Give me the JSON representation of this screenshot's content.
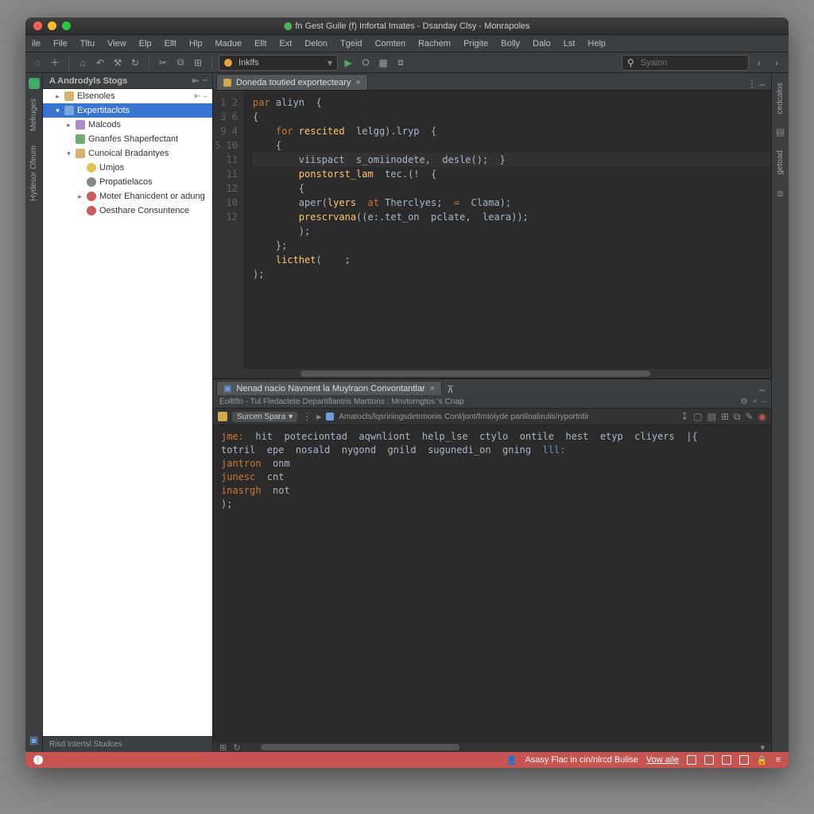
{
  "title": "fn Gest Guile (f) Infortal Imates - Dsanday Clsy - Monrapoles",
  "menu": [
    "ile",
    "File",
    "Tltu",
    "View",
    "Elp",
    "Ellt",
    "Hlp",
    "Madue",
    "Ellt",
    "Ext",
    "Delon",
    "Tgeid",
    "Comten",
    "Rachem",
    "Prigite",
    "Bolly",
    "Dalo",
    "Lst",
    "Help"
  ],
  "runconfig": "Inklfs",
  "search_ph": "Syaion",
  "left_tabs": [
    "Mełruges",
    "Hydesor Ofeum"
  ],
  "right_tabs": [
    "cedcałos",
    "getoad"
  ],
  "sidebar": {
    "title": "A Androdyls Stogs",
    "foot": "Risd Intertsl Studces",
    "items": [
      {
        "ind": 0,
        "chev": "▸",
        "ic": "folder",
        "lbl": "Elsenoles",
        "sel": false,
        "ctrls": true
      },
      {
        "ind": 0,
        "chev": "▾",
        "ic": "pkg",
        "lbl": "Expertitaclots",
        "sel": true
      },
      {
        "ind": 1,
        "chev": "▸",
        "ic": "mod",
        "lbl": "Malcods",
        "sel": false
      },
      {
        "ind": 1,
        "chev": "",
        "ic": "cls",
        "lbl": "Gnanfes Shaperfectant",
        "sel": false
      },
      {
        "ind": 1,
        "chev": "▾",
        "ic": "folder",
        "lbl": "Cunoical Bradantyes",
        "sel": false
      },
      {
        "ind": 2,
        "chev": "",
        "ic": "bulb",
        "lbl": "Umjos",
        "sel": false
      },
      {
        "ind": 2,
        "chev": "",
        "ic": "gear",
        "lbl": "Propatielacos",
        "sel": false
      },
      {
        "ind": 2,
        "chev": "▸",
        "ic": "red",
        "lbl": "Moter Ehanicdent or adung",
        "sel": false
      },
      {
        "ind": 2,
        "chev": "",
        "ic": "red",
        "lbl": "Oesthare Consuntence",
        "sel": false
      }
    ]
  },
  "editor_tab": "Doneda toutied exportecteary",
  "lines": [
    "1",
    "2",
    "3",
    "6",
    "9",
    "4",
    "5",
    "10",
    "11",
    "11",
    "12",
    "10",
    "12"
  ],
  "code": {
    "l1a": "par",
    "l1b": " aliyn  {",
    "l2": "{",
    "l3a": "    for",
    "l3b": " rescited",
    "l3c": "  lelgg).lryp  {",
    "l4": "    {",
    "l5": "        viispact  s_omiinodete,  desle();  }",
    "l6a": "        ponstorst_lam",
    "l6b": "  tec.(!  {",
    "l7": "        {",
    "l8a": "        aper(",
    "l8b": "lyers  ",
    "l8c": "at",
    "l8d": " Therclyes;  ",
    "l8e": "=",
    "l8f": "  Clama);",
    "l9a": "        prescrvana",
    "l9b": "((e:.tet_on  pclate,  leara));",
    "l10": "        );",
    "l11": "    };",
    "l12a": "    licthet",
    "l12b": "(    ;",
    "l13": ");"
  },
  "bottom": {
    "tab": "Nenad nacio Navnent la Muylraon Convontantlar",
    "sub": "Eolltfln -  Tul Fledactete Departiflantris Marttons : Mnvtorngtos 's Cnap",
    "chip": "Surcen Spara",
    "path": "Amatocls/lqsriningsdetrmonis Conl/jont/frntolyde partilnatirulis/ryportritir",
    "con1a": "jme:",
    "con1b": "  hit  poteciontad  aqwnliont  help_lse  ctylo  ontile  hest  etyp  cliyers  |{",
    "con2a": "totril  epe  nosald  nygond  gnild  sugunedi_on  gning  ",
    "con2b": "lll:",
    "con3a": "jantron",
    "con3b": "  onm",
    "con4a": "junesc",
    "con4b": "  cnt",
    "con5a": "inasrgh",
    "con5b": "  not",
    "con6": ");"
  },
  "status": {
    "msg": "Asasy Flac in cin/nlrcd Bulise",
    "link": "Vow aile"
  }
}
